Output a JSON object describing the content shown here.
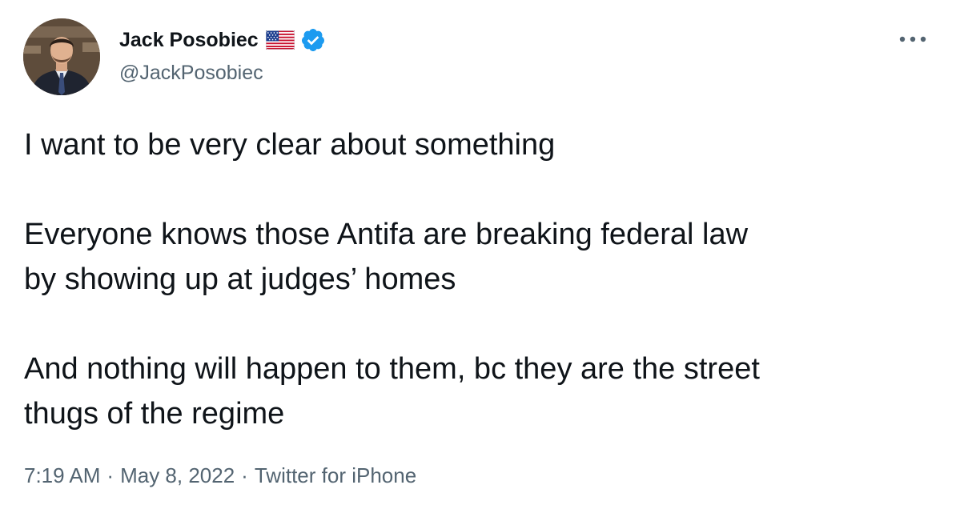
{
  "author": {
    "display_name": "Jack Posobiec",
    "handle": "@JackPosobiec",
    "flag_icon": "us-flag-icon",
    "verified_icon": "verified-badge-icon",
    "verified_color": "#1d9bf0"
  },
  "tweet": {
    "lines": [
      "I want to be very clear about something",
      "",
      "Everyone knows those Antifa are breaking federal law",
      "by showing up at judges’ homes",
      "",
      "And nothing will happen to them, bc they are the street",
      "thugs of the regime"
    ]
  },
  "meta": {
    "time": "7:19 AM",
    "date": "May 8, 2022",
    "source": "Twitter for iPhone",
    "separator": "·"
  },
  "menu": {
    "icon": "more-options-icon"
  }
}
